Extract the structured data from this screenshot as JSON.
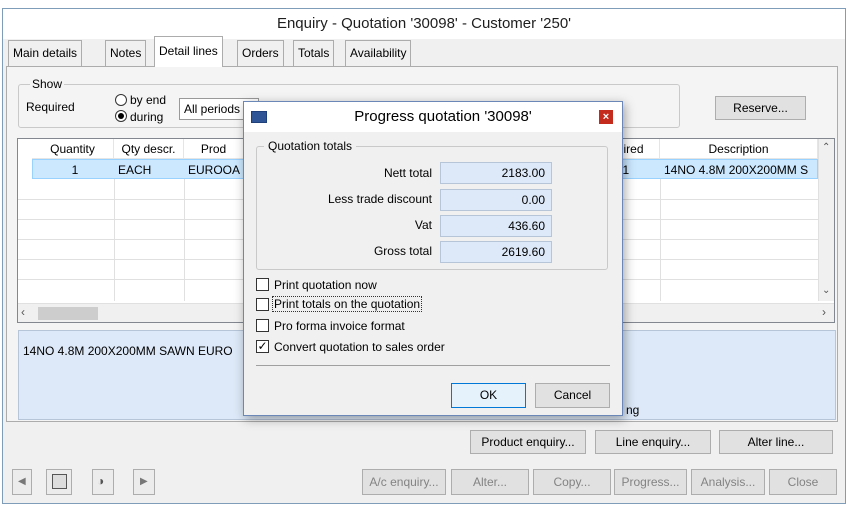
{
  "window": {
    "title": "Enquiry - Quotation '30098' - Customer '250'"
  },
  "tabs": [
    {
      "label": "Main details"
    },
    {
      "label": "Notes"
    },
    {
      "label": "Detail lines"
    },
    {
      "label": "Orders"
    },
    {
      "label": "Totals"
    },
    {
      "label": "Availability"
    }
  ],
  "show": {
    "legend": "Show",
    "required_label": "Required",
    "by_end_label": "by end",
    "during_label": "during",
    "period_value": "All periods",
    "reserve_label": "Reserve..."
  },
  "grid": {
    "headers": [
      "Quantity",
      "Qty descr.",
      "Prod",
      "ired",
      "Description"
    ],
    "row1": {
      "quantity": "1",
      "qty_descr": "EACH",
      "product": "EUROOA",
      "required": "011",
      "description": "14NO 4.8M 200X200MM S"
    }
  },
  "memo_text": "14NO 4.8M 200X200MM SAWN EURO",
  "partial_text": "ng",
  "actions": {
    "product_enquiry": "Product enquiry...",
    "line_enquiry": "Line enquiry...",
    "alter_line": "Alter line..."
  },
  "footer": {
    "ac_enquiry": "A/c enquiry...",
    "alter": "Alter...",
    "copy": "Copy...",
    "progress": "Progress...",
    "analysis": "Analysis...",
    "close": "Close"
  },
  "dialog": {
    "title": "Progress quotation '30098'",
    "group_label": "Quotation totals",
    "nett_total_label": "Nett total",
    "nett_total": "2183.00",
    "discount_label": "Less trade discount",
    "discount": "0.00",
    "vat_label": "Vat",
    "vat": "436.60",
    "gross_total_label": "Gross total",
    "gross_total": "2619.60",
    "print_now_label": "Print quotation now",
    "print_totals_label": "Print totals on the quotation",
    "pro_forma_label": "Pro forma invoice format",
    "convert_label": "Convert quotation to sales order",
    "ok_label": "OK",
    "cancel_label": "Cancel"
  },
  "colors": {
    "selection": "#cce8ff",
    "memo_bg": "#dde9f8",
    "close_x": "#c42b1c"
  }
}
